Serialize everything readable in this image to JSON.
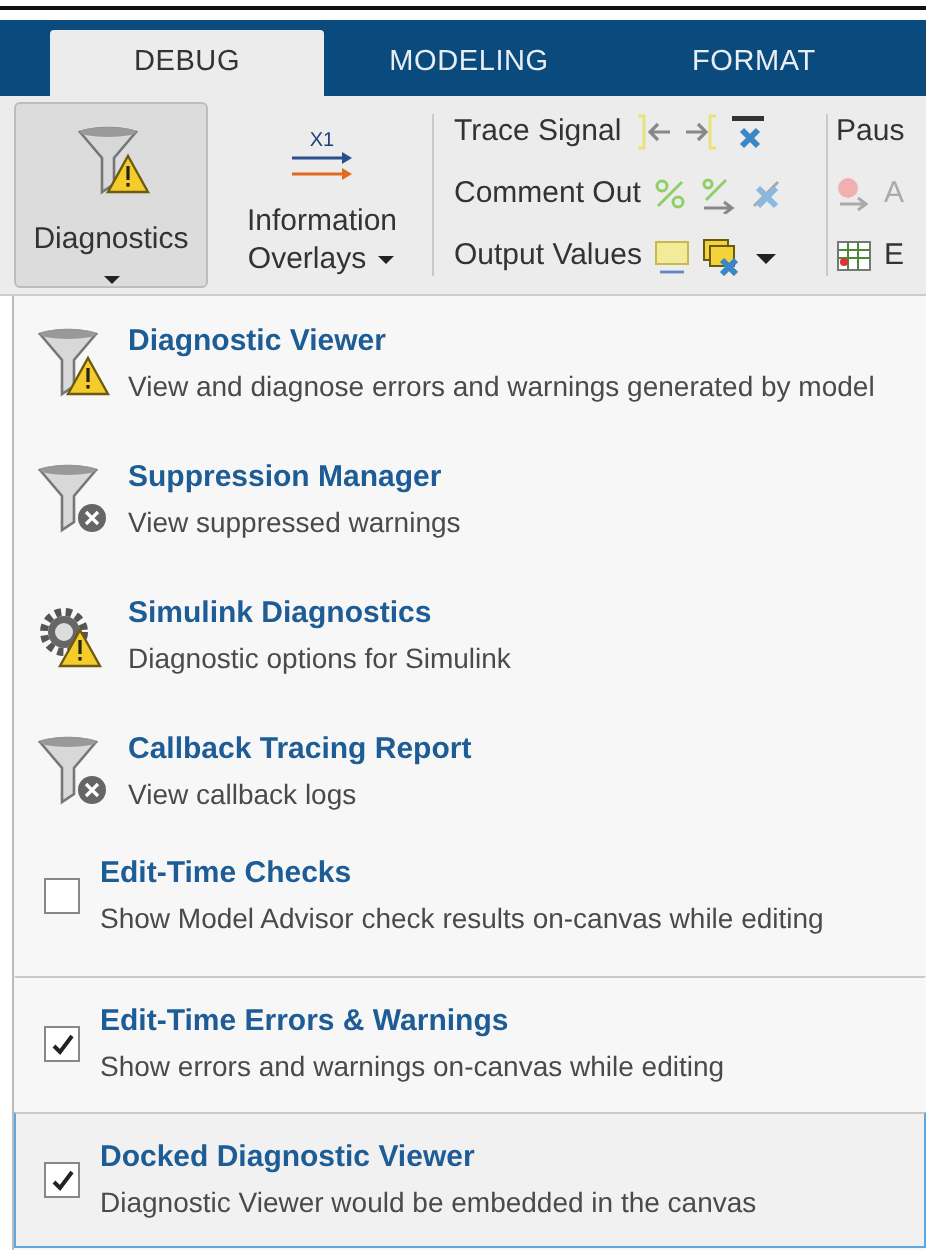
{
  "tabs": [
    {
      "label": "DEBUG",
      "selected": true
    },
    {
      "label": "MODELING",
      "selected": false
    },
    {
      "label": "FORMAT",
      "selected": false
    }
  ],
  "toolbar": {
    "diagnostics_button": {
      "label": "Diagnostics",
      "pressed": true
    },
    "overlays_button": {
      "icon_label": "X1",
      "label": "Information Overlays"
    },
    "rows": [
      {
        "label": "Trace Signal"
      },
      {
        "label": "Comment Out"
      },
      {
        "label": "Output Values"
      }
    ],
    "cut_column": [
      {
        "label": "Paus",
        "disabled": false
      },
      {
        "label": "A",
        "disabled": true
      },
      {
        "label": "E",
        "disabled": false
      }
    ]
  },
  "menu": [
    {
      "kind": "funnel-warning",
      "title": "Diagnostic Viewer",
      "description": "View and diagnose errors and warnings generated by model",
      "selected": false
    },
    {
      "kind": "funnel-cross",
      "title": "Suppression Manager",
      "description": "View suppressed warnings",
      "selected": false
    },
    {
      "kind": "gear-warning",
      "title": "Simulink Diagnostics",
      "description": "Diagnostic options for Simulink",
      "selected": false
    },
    {
      "kind": "funnel-cross",
      "title": "Callback Tracing Report",
      "description": "View callback logs",
      "selected": false
    },
    {
      "kind": "check",
      "title": "Edit-Time Checks",
      "description": "Show Model Advisor check results on-canvas while editing",
      "checked": false,
      "selected": false
    },
    {
      "kind": "check",
      "title": "Edit-Time Errors & Warnings",
      "description": "Show errors and warnings on-canvas while editing",
      "checked": true,
      "selected": false
    },
    {
      "kind": "check",
      "title": "Docked Diagnostic Viewer",
      "description": "Diagnostic Viewer would be embedded in the canvas",
      "checked": true,
      "selected": true
    }
  ]
}
